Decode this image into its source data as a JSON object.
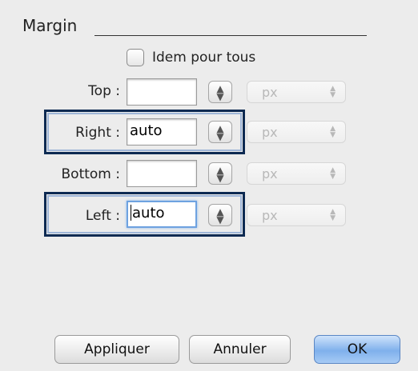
{
  "section": {
    "title": "Margin"
  },
  "same_for_all": {
    "label": "Idem pour tous",
    "checked": false
  },
  "rows": [
    {
      "key": "top",
      "label": "Top :",
      "value": "",
      "unit": "px"
    },
    {
      "key": "right",
      "label": "Right :",
      "value": "auto",
      "unit": "px"
    },
    {
      "key": "bottom",
      "label": "Bottom :",
      "value": "",
      "unit": "px"
    },
    {
      "key": "left",
      "label": "Left :",
      "value": "auto",
      "unit": "px"
    }
  ],
  "buttons": {
    "apply": "Appliquer",
    "cancel": "Annuler",
    "ok": "OK"
  },
  "colors": {
    "highlight_border": "#0d2a52",
    "focus_ring": "#6ea2e0",
    "default_button": "#7fb0ec"
  }
}
